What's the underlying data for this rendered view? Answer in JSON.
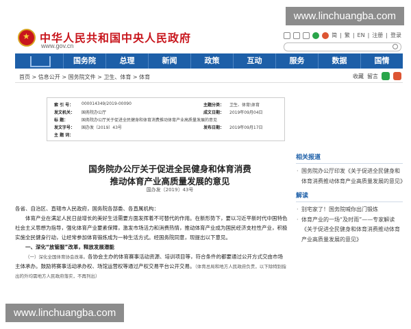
{
  "watermark": {
    "top": "www.linchuangba.com",
    "bottom": "www.linchuangba.com"
  },
  "header": {
    "site_title": "中华人民共和国中央人民政府",
    "site_url": "www.gov.cn",
    "links": [
      "简",
      "繁",
      "EN",
      "注册",
      "登录"
    ]
  },
  "nav": {
    "items": [
      "国务院",
      "总理",
      "新闻",
      "政策",
      "互动",
      "服务",
      "数据",
      "国情"
    ]
  },
  "breadcrumb": {
    "trail": "首页 > 信息公开 > 国务院文件 > 卫生、体育 > 体育",
    "tools": [
      "收藏",
      "留言"
    ]
  },
  "meta": {
    "index_label": "索  引  号：",
    "index_value": "000014349/2019-00090",
    "topic_label": "主题分类：",
    "topic_value": "卫生、体育\\体育",
    "issuer_label": "发文机关：",
    "issuer_value": "国务院办公厅",
    "date_label": "成文日期：",
    "date_value": "2019年09月04日",
    "title_label": "标      题：",
    "title_value": "国务院办公厅关于促进全民健身和体育消费推动体育产业高质量发展的意见",
    "number_label": "发文字号：",
    "number_value": "国办发〔2019〕43号",
    "publish_label": "发布日期：",
    "publish_value": "2019年09月17日",
    "subject_label": "主  题  词：",
    "subject_value": ""
  },
  "doc": {
    "title_line1": "国务院办公厅关于促进全民健身和体育消费",
    "title_line2": "推动体育产业高质量发展的意见",
    "doc_number": "国办发〔2019〕43号",
    "addressee": "各省、自治区、直辖市人民政府，国务院各部委、各直属机构：",
    "para1": "体育产业在满足人民日益增长的美好生活需要方面发挥着不可替代的作用。在新形势下，要以习近平新时代中国特色社会主义思想为指导，强化体育产业要素保障，激发市场活力和消费热情，推动体育产业成为国民经济支柱性产业，积极实施全民健身行动，让经常参加体育锻炼成为一种生活方式。经国务院同意，现提出以下意见。",
    "section1": "一、深化“放管服”改革，释放发展潜能",
    "para2_head": "（一）深化全国体育协会改革。",
    "para2": "各协会主办的体育赛事活动资源、培训项目等，符合条件的都要通过公开方式交由市场主体承办。鼓励将赛事活动承办权、场馆运营权等通过产权交易平台公开交易。",
    "para2_note": "（体育总局和地方人民政府负责，以下除特别指出的外均需地方人民政府落实，不再列出）"
  },
  "sidebar": {
    "related_title": "相关报道",
    "related": [
      "国务院办公厅印发《关于促进全民健身和体育消费推动体育产业高质量发展的意见》"
    ],
    "interp_title": "解读",
    "interp": [
      "别宅家了！国务院喊你出门锻炼",
      "体育产业的一场“及时雨”——专家解读《关于促进全民健身和体育消费推动体育产业高质量发展的意见》"
    ]
  }
}
